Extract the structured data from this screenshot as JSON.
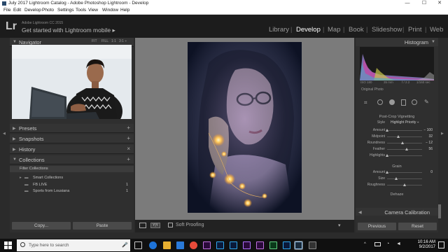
{
  "window": {
    "title": "July 2017 Lightroom Catalog - Adobe Photoshop Lightroom - Develop",
    "minimize": "—",
    "maximize": "☐",
    "close": "✕"
  },
  "menu": [
    "File",
    "Edit",
    "Develop",
    "Photo",
    "Settings",
    "Tools",
    "View",
    "Window",
    "Help"
  ],
  "header": {
    "logo": "Lr",
    "cc_label": "Adobe Lightroom CC 2015",
    "mobile_label": "Get started with Lightroom mobile ▸",
    "modules": [
      "Library",
      "Develop",
      "Map",
      "Book",
      "Slideshow",
      "Print",
      "Web"
    ],
    "active_module": "Develop",
    "separator": "|"
  },
  "left_panel": {
    "navigator": {
      "label": "Navigator",
      "zoom": [
        "FIT",
        "FILL",
        "1:1",
        "3:1 ÷"
      ]
    },
    "sections": [
      {
        "label": "Presets",
        "action": "+"
      },
      {
        "label": "Snapshots",
        "action": "+"
      },
      {
        "label": "History",
        "action": "×"
      },
      {
        "label": "Collections",
        "action": "+"
      }
    ],
    "collections": {
      "filter": "Filter Collections",
      "items": [
        {
          "name": "Smart Collections",
          "count": ""
        },
        {
          "name": "FB LIVE",
          "count": "1"
        },
        {
          "name": "Sports from Lousiana",
          "count": "1"
        }
      ]
    },
    "copy_button": "Copy...",
    "paste_button": "Paste"
  },
  "toolbar": {
    "soft_proofing": "Soft Proofing"
  },
  "right_panel": {
    "histogram_label": "Histogram",
    "exif": [
      "ISO 180",
      "35 mm",
      "f / 2.2",
      "1/160 sec"
    ],
    "original_photo": "Original Photo",
    "post_crop": {
      "title": "Post-Crop Vignetting",
      "style_label": "Style",
      "style_value": "Highlight Priority ÷",
      "sliders": [
        {
          "label": "Amount",
          "value": "− 100",
          "level": 0.0
        },
        {
          "label": "Midpoint",
          "value": "32",
          "level": 0.32
        },
        {
          "label": "Roundness",
          "value": "− 12",
          "level": 0.44
        },
        {
          "label": "Feather",
          "value": "56",
          "level": 0.56
        },
        {
          "label": "Highlights",
          "value": "",
          "level": 0.0
        }
      ]
    },
    "grain": {
      "title": "Grain",
      "sliders": [
        {
          "label": "Amount",
          "value": "0",
          "level": 0.0
        },
        {
          "label": "Size",
          "value": "",
          "level": 0.25
        },
        {
          "label": "Roughness",
          "value": "",
          "level": 0.5
        }
      ]
    },
    "dehaze_title": "Dehaze",
    "camera_calibration": "Camera Calibration",
    "previous_button": "Previous",
    "reset_button": "Reset"
  },
  "taskbar": {
    "search_placeholder": "Type here to search",
    "time": "10:16 AM",
    "date": "9/2/2017"
  },
  "colors": {
    "accent_active": "#ffffff",
    "panel_bg": "#2f2f2f",
    "center_bg": "#7b7b7b"
  }
}
